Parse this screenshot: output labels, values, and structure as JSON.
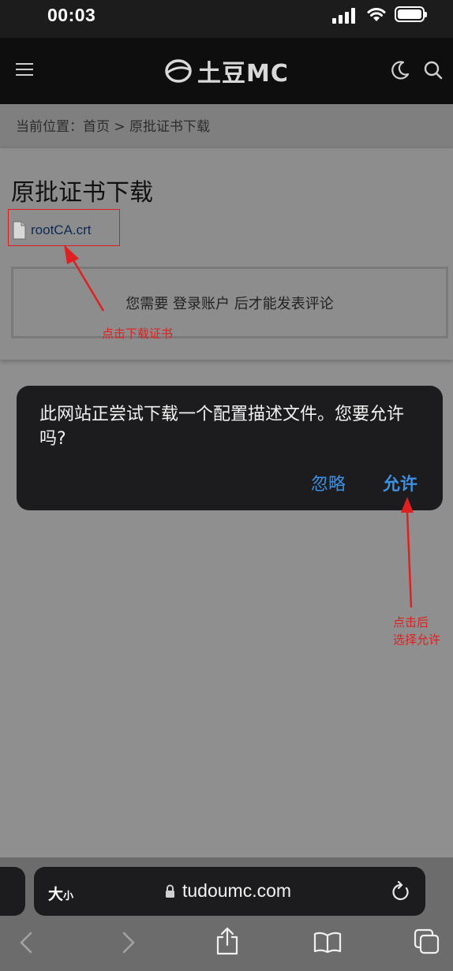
{
  "status_bar": {
    "time": "00:03"
  },
  "header": {
    "logo_text": "土豆MC",
    "icons": [
      "menu-icon",
      "logo-icon",
      "moon-icon",
      "search-icon"
    ]
  },
  "breadcrumb": {
    "text": "当前位置：首页 > 原批证书下载"
  },
  "content": {
    "title": "原批证书下载",
    "file_name": "rootCA.crt",
    "login_prompt": "您需要 登录账户 后才能发表评论",
    "annotation_download": "点击下载证书",
    "annotation_allow_line1": "点击后",
    "annotation_allow_line2": "选择允许"
  },
  "dialog": {
    "message": "此网站正尝试下载一个配置描述文件。您要允许吗?",
    "ignore_label": "忽略",
    "allow_label": "允许"
  },
  "browser": {
    "text_size_big": "大",
    "text_size_small": "小",
    "url": "tudoumc.com",
    "toolbar_icons": [
      "back-icon",
      "forward-icon",
      "share-icon",
      "bookmarks-icon",
      "tabs-icon"
    ]
  },
  "colors": {
    "link": "#0c2a55",
    "dialog_button": "#3d8fe0",
    "annotation": "#e02020"
  }
}
